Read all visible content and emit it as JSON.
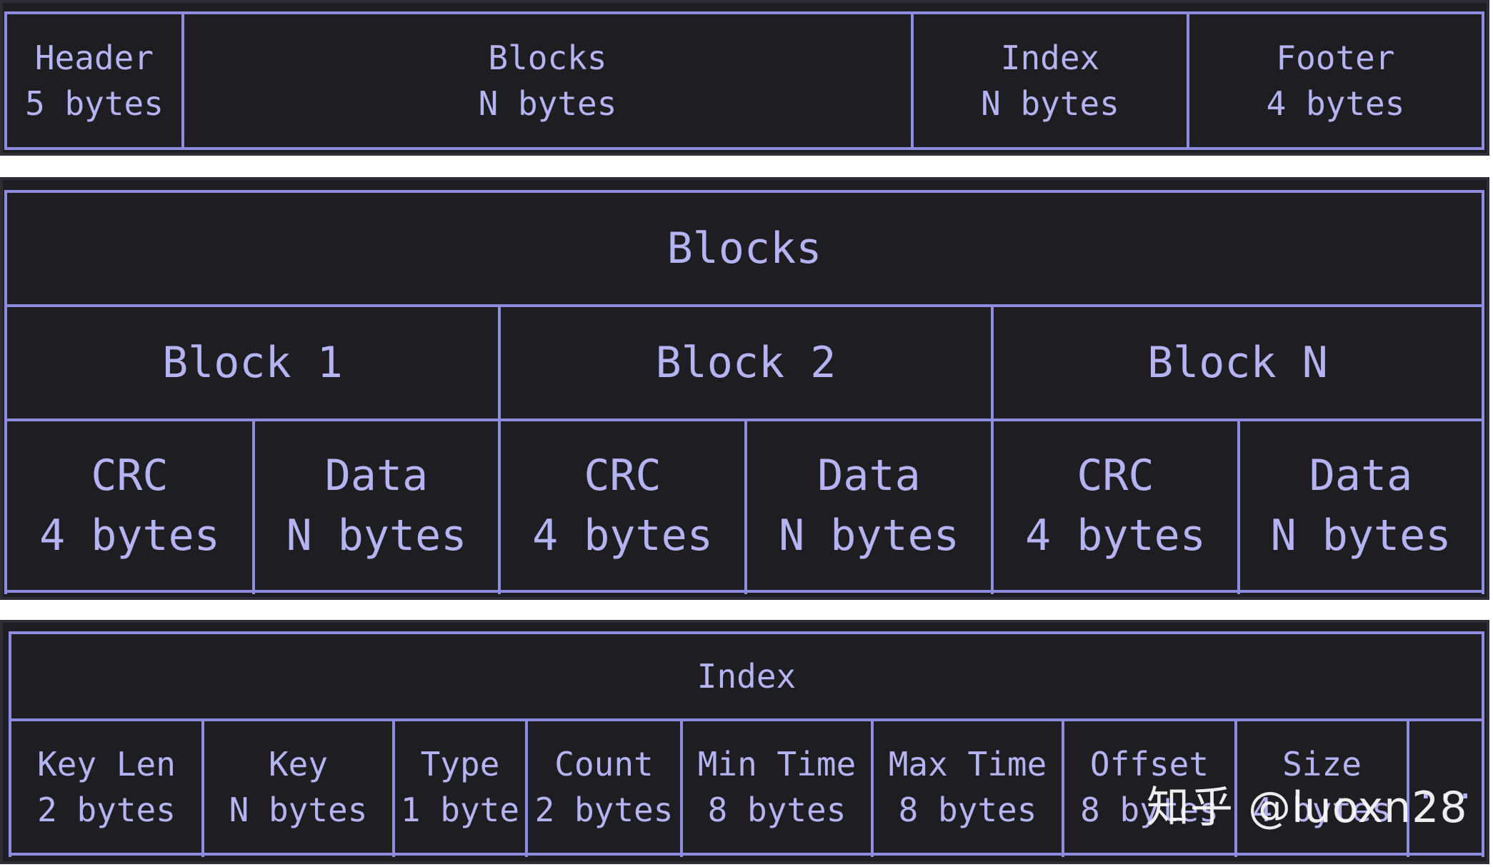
{
  "layout_panel": {
    "columns": [
      {
        "title": "Header",
        "size": "5 bytes"
      },
      {
        "title": "Blocks",
        "size": "N bytes"
      },
      {
        "title": "Index",
        "size": "N bytes"
      },
      {
        "title": "Footer",
        "size": "4 bytes"
      }
    ]
  },
  "blocks_panel": {
    "title": "Blocks",
    "blocks": [
      {
        "name": "Block 1",
        "crc_label": "CRC",
        "crc_size": "4 bytes",
        "data_label": "Data",
        "data_size": "N bytes"
      },
      {
        "name": "Block 2",
        "crc_label": "CRC",
        "crc_size": "4 bytes",
        "data_label": "Data",
        "data_size": "N bytes"
      },
      {
        "name": "Block N",
        "crc_label": "CRC",
        "crc_size": "4 bytes",
        "data_label": "Data",
        "data_size": "N bytes"
      }
    ]
  },
  "index_panel": {
    "title": "Index",
    "fields": [
      {
        "title": "Key Len",
        "size": "2 bytes"
      },
      {
        "title": "Key",
        "size": "N bytes"
      },
      {
        "title": "Type",
        "size": "1 byte"
      },
      {
        "title": "Count",
        "size": "2 bytes"
      },
      {
        "title": "Min Time",
        "size": "8 bytes"
      },
      {
        "title": "Max Time",
        "size": "8 bytes"
      },
      {
        "title": "Offset",
        "size": "8 bytes"
      },
      {
        "title": "Size",
        "size": "4 bytes"
      },
      {
        "title": "...",
        "size": ""
      }
    ]
  },
  "watermark": "知乎 @luoxn28",
  "colors": {
    "panel_bg": "#1e1d21",
    "line": "#8f8ce0",
    "text": "#b6b3f2"
  }
}
